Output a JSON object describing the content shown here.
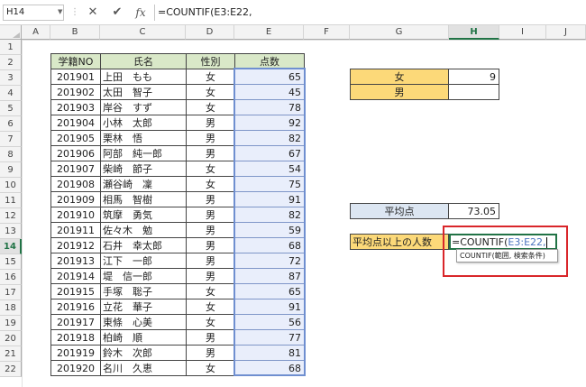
{
  "formula_bar": {
    "name_box": "H14",
    "cancel_icon": "✕",
    "enter_icon": "✔",
    "fx_label": "fx",
    "formula": "=COUNTIF(E3:E22,"
  },
  "columns": [
    "A",
    "B",
    "C",
    "D",
    "E",
    "F",
    "G",
    "H",
    "I",
    "J"
  ],
  "rows": [
    "1",
    "2",
    "3",
    "4",
    "5",
    "6",
    "7",
    "8",
    "9",
    "10",
    "11",
    "12",
    "13",
    "14",
    "15",
    "16",
    "17",
    "18",
    "19",
    "20",
    "21",
    "22"
  ],
  "table": {
    "headers": [
      "学籍NO",
      "氏名",
      "性別",
      "点数"
    ],
    "records": [
      [
        "201901",
        "上田　もも",
        "女",
        "65"
      ],
      [
        "201902",
        "太田　智子",
        "女",
        "45"
      ],
      [
        "201903",
        "岸谷　すず",
        "女",
        "78"
      ],
      [
        "201904",
        "小林　太郎",
        "男",
        "92"
      ],
      [
        "201905",
        "栗林　悟",
        "男",
        "82"
      ],
      [
        "201906",
        "阿部　純一郎",
        "男",
        "67"
      ],
      [
        "201907",
        "柴崎　節子",
        "女",
        "54"
      ],
      [
        "201908",
        "瀬谷崎　凜",
        "女",
        "75"
      ],
      [
        "201909",
        "相馬　智樹",
        "男",
        "91"
      ],
      [
        "201910",
        "筑摩　勇気",
        "男",
        "82"
      ],
      [
        "201911",
        "佐々木　勉",
        "男",
        "59"
      ],
      [
        "201912",
        "石井　幸太郎",
        "男",
        "68"
      ],
      [
        "201913",
        "江下　一郎",
        "男",
        "72"
      ],
      [
        "201914",
        "堤　信一郎",
        "男",
        "87"
      ],
      [
        "201915",
        "手塚　聡子",
        "女",
        "65"
      ],
      [
        "201916",
        "立花　華子",
        "女",
        "91"
      ],
      [
        "201917",
        "東條　心美",
        "女",
        "56"
      ],
      [
        "201918",
        "柏崎　順",
        "男",
        "77"
      ],
      [
        "201919",
        "鈴木　次郎",
        "男",
        "81"
      ],
      [
        "201920",
        "名川　久恵",
        "女",
        "68"
      ]
    ]
  },
  "summary": {
    "female_label": "女",
    "female_count": "9",
    "male_label": "男",
    "male_count": "",
    "avg_label": "平均点",
    "avg_value": "73.05",
    "above_label": "平均点以上の人数",
    "above_formula_prefix": "=COUNTIF(",
    "above_formula_ref": "E3:E22,"
  },
  "tooltip": {
    "text": "COUNTIF(範囲, 検索条件)"
  },
  "colors": {
    "header_fill": "#d9e8c8",
    "yellow_fill": "#fcd979",
    "blue_fill": "#dce6f2",
    "range_fill": "#e9eefb",
    "highlight_box": "#d9262a",
    "ref_blue": "#4b74c0"
  }
}
